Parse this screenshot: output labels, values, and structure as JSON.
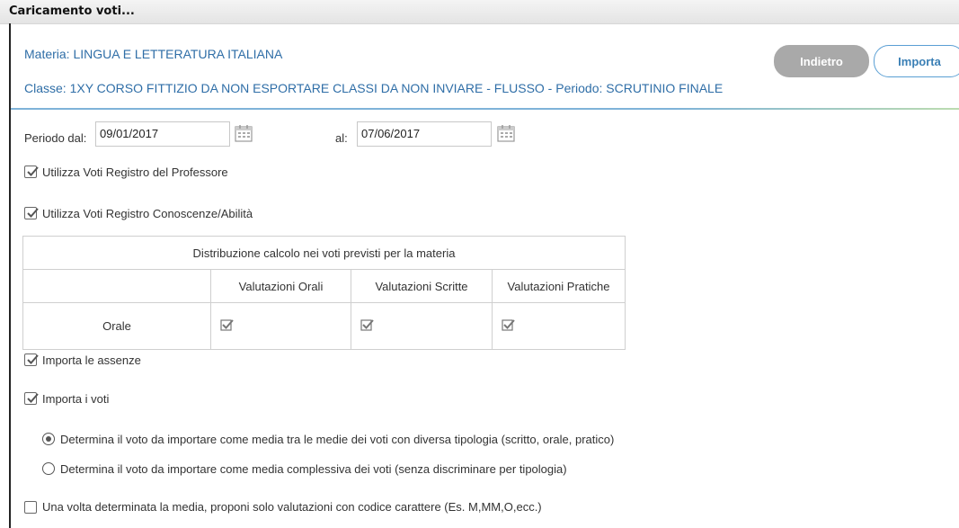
{
  "window": {
    "title": "Caricamento voti..."
  },
  "header": {
    "materia": "Materia: LINGUA E LETTERATURA ITALIANA",
    "classe": "Classe: 1XY CORSO FITTIZIO DA NON ESPORTARE CLASSI DA NON INVIARE - FLUSSO - Periodo: SCRUTINIO FINALE",
    "back_label": "Indietro",
    "import_label": "Importa"
  },
  "period": {
    "from_label": "Periodo dal:",
    "from_value": "09/01/2017",
    "to_label": "al:",
    "to_value": "07/06/2017"
  },
  "options": {
    "registro_prof": {
      "label": "Utilizza Voti Registro del Professore",
      "checked": true
    },
    "registro_conoscenze": {
      "label": "Utilizza Voti Registro Conoscenze/Abilità",
      "checked": true
    },
    "assenze": {
      "label": "Importa le assenze",
      "checked": true
    },
    "voti": {
      "label": "Importa i voti",
      "checked": true
    },
    "radio_media_tipologia": {
      "label": "Determina il voto da importare come media tra le medie dei voti con diversa tipologia (scritto, orale, pratico)",
      "selected": true
    },
    "radio_media_complessiva": {
      "label": "Determina il voto da importare come media complessiva dei voti (senza discriminare per tipologia)",
      "selected": false
    },
    "codice_carattere": {
      "label": "Una volta determinata la media, proponi solo valutazioni con codice carattere (Es. M,MM,O,ecc.)",
      "checked": false
    }
  },
  "distribution_table": {
    "title": "Distribuzione calcolo nei voti previsti per la materia",
    "columns": [
      "Valutazioni Orali",
      "Valutazioni Scritte",
      "Valutazioni Pratiche"
    ],
    "rows": [
      {
        "label": "Orale",
        "values": [
          true,
          true,
          true
        ]
      }
    ]
  },
  "colors": {
    "accent": "#2f6ea7",
    "back_button": "#a9a9a9",
    "import_border": "#5a9fd4",
    "table_border": "#4a90c2"
  }
}
